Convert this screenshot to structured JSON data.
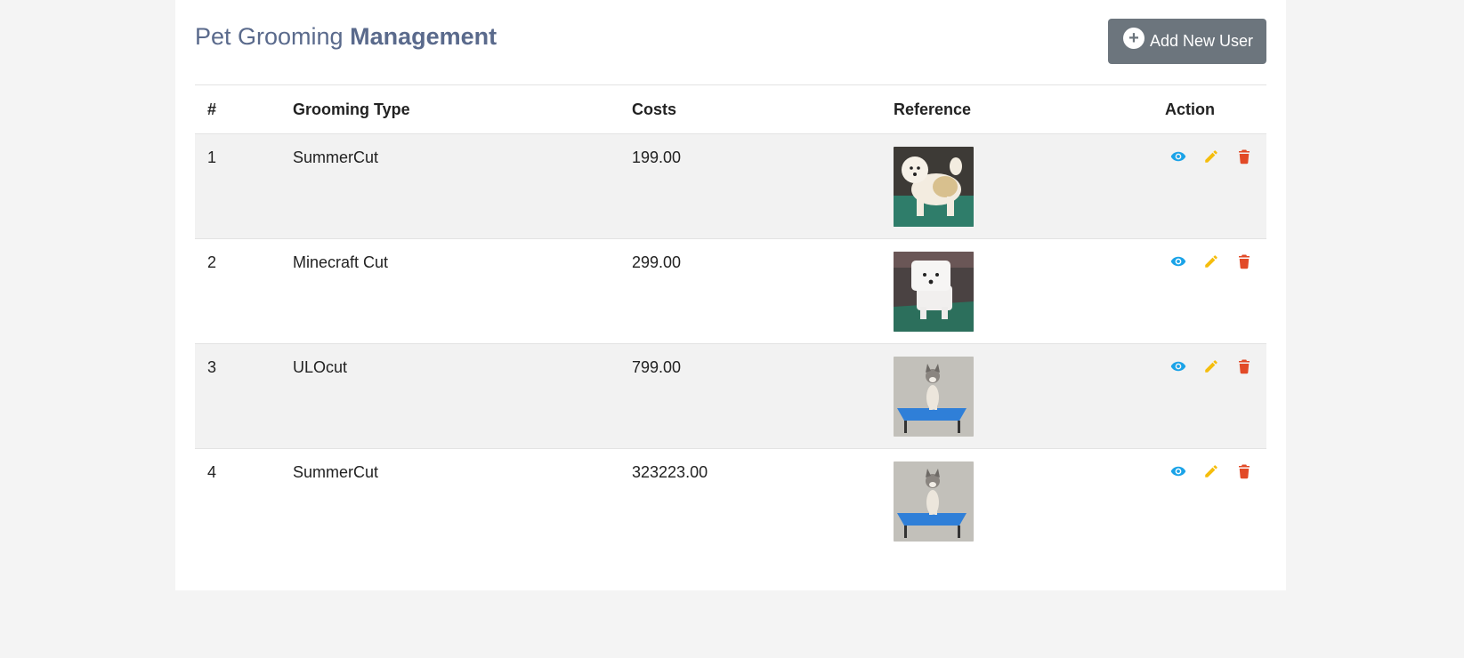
{
  "header": {
    "title_light": "Pet Grooming",
    "title_strong": "Management",
    "add_button_label": "Add New User",
    "add_button_icon": "plus-circle-icon"
  },
  "table": {
    "columns": [
      "#",
      "Grooming Type",
      "Costs",
      "Reference",
      "Action"
    ],
    "rows": [
      {
        "num": "1",
        "type": "SummerCut",
        "cost": "199.00",
        "reference": "fluffy-white-tan-dog-photo"
      },
      {
        "num": "2",
        "type": "Minecraft Cut",
        "cost": "299.00",
        "reference": "white-square-cut-dog-photo"
      },
      {
        "num": "3",
        "type": "ULOcut",
        "cost": "799.00",
        "reference": "husky-on-blue-table-photo"
      },
      {
        "num": "4",
        "type": "SummerCut",
        "cost": "323223.00",
        "reference": "husky-on-blue-table-photo"
      }
    ]
  },
  "actions": {
    "view_icon": "eye-icon",
    "edit_icon": "pencil-icon",
    "delete_icon": "trash-icon"
  },
  "colors": {
    "title": "#5a6a8c",
    "button_bg": "#6c757d",
    "view": "#1aa3e8",
    "edit": "#f5bd0c",
    "delete": "#e24a27",
    "stripe": "#f2f2f2",
    "page_bg": "#f4f4f4"
  }
}
